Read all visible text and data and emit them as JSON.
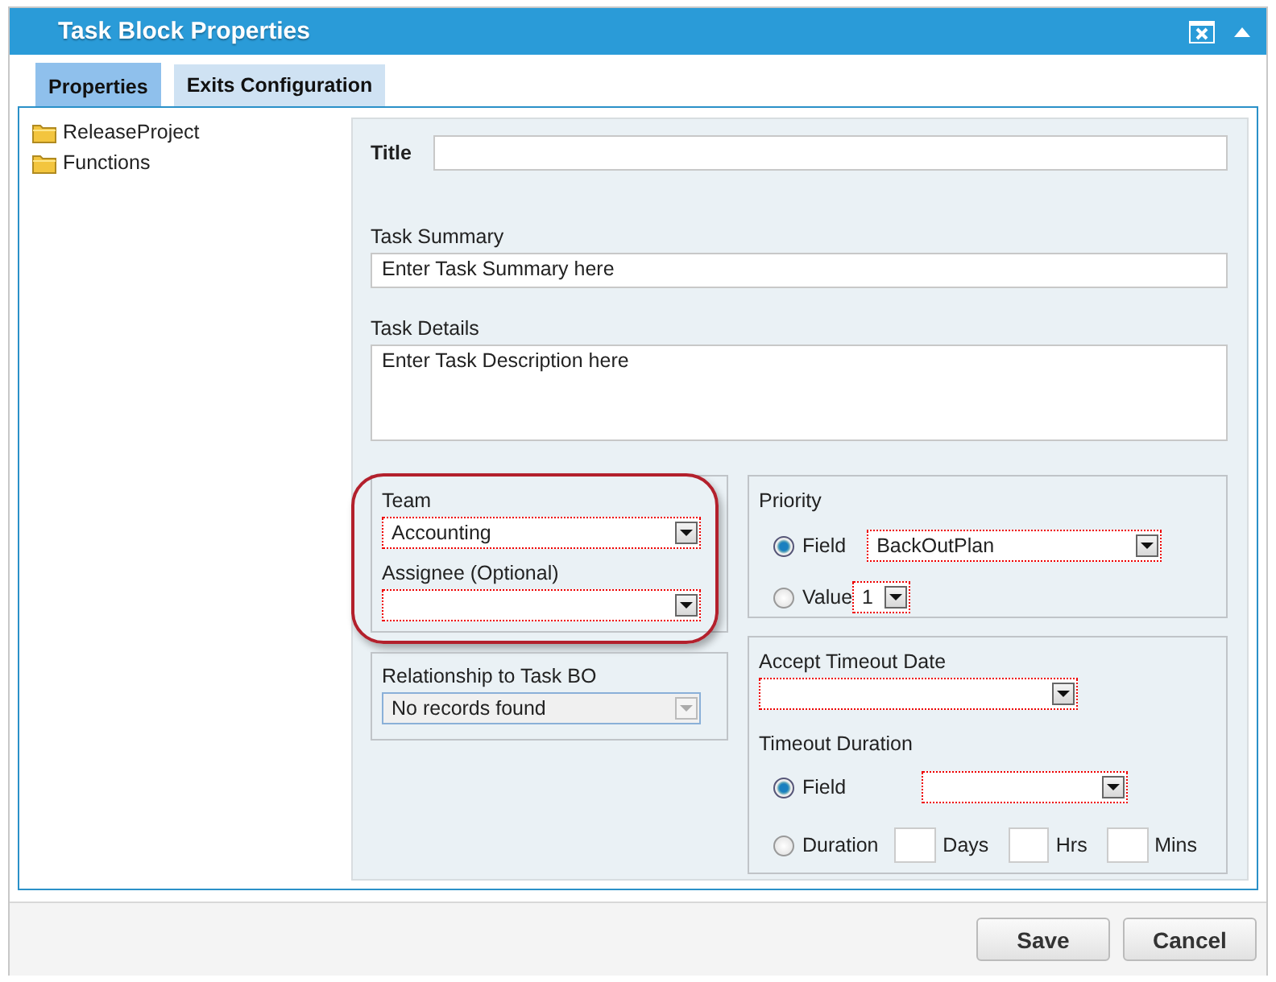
{
  "window": {
    "title": "Task Block Properties"
  },
  "tabs": [
    {
      "label": "Properties",
      "selected": true
    },
    {
      "label": "Exits Configuration",
      "selected": false
    }
  ],
  "tree": [
    {
      "label": "ReleaseProject"
    },
    {
      "label": "Functions"
    }
  ],
  "form": {
    "title": {
      "label": "Title"
    },
    "summary": {
      "label": "Task Summary",
      "value": "Enter Task Summary here"
    },
    "details": {
      "label": "Task Details",
      "value": "Enter Task Description here"
    },
    "team_highlighted": true,
    "team": {
      "label": "Team",
      "value": "Accounting",
      "required": true
    },
    "assignee": {
      "label": "Assignee (Optional)",
      "required": true
    },
    "relationship": {
      "label": "Relationship to Task BO",
      "value": "No records found",
      "disabled": true
    },
    "priority": {
      "label": "Priority",
      "options": [
        {
          "label": "Field",
          "selected": true,
          "kind": "dropdown",
          "value": "BackOutPlan",
          "required": true
        },
        {
          "label": "Value",
          "selected": false,
          "kind": "small-dropdown",
          "value": "1",
          "required": true
        }
      ]
    },
    "accept_timeout": {
      "label": "Accept Timeout Date",
      "required": true
    },
    "timeout_duration": {
      "label": "Timeout Duration",
      "options": [
        {
          "label": "Field",
          "selected": true,
          "kind": "dropdown",
          "required": true
        },
        {
          "label": "Duration",
          "selected": false,
          "kind": "units",
          "units": [
            "Days",
            "Hrs",
            "Mins"
          ]
        }
      ]
    }
  },
  "buttons": [
    "Save",
    "Cancel"
  ]
}
